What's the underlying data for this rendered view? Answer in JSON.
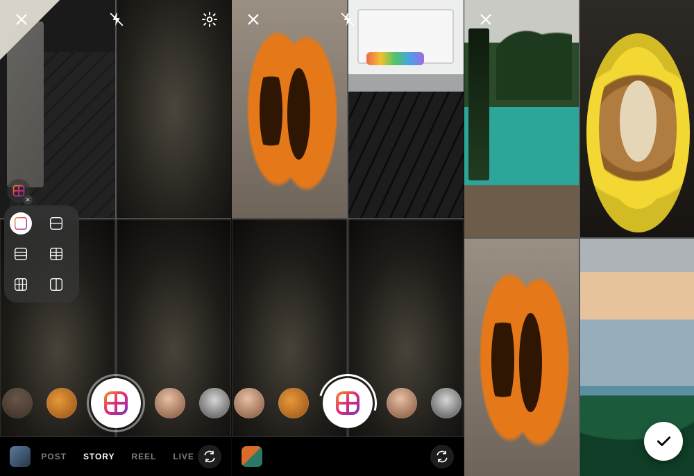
{
  "screens": {
    "left": {
      "topbar": {
        "close": "close-icon",
        "flash": "flash-off-icon",
        "settings": "settings-icon"
      },
      "layout_mini_icon": "layout-icon",
      "layout_options": [
        "grid-2x2",
        "rows-4",
        "rows-3",
        "grid-2x3",
        "grid-3x2",
        "cols-2"
      ],
      "layout_selected": "grid-2x2",
      "effects": [
        "face-dim",
        "food",
        "layout",
        "face",
        "alien"
      ],
      "modes": [
        "POST",
        "STORY",
        "REEL",
        "LIVE"
      ],
      "mode_active": "STORY",
      "gallery_thumb": "recent-photo",
      "switch_cam": "switch-camera-icon"
    },
    "middle": {
      "topbar": {
        "close": "close-icon",
        "flash": "flash-off-icon"
      },
      "filled": {
        "tl": "papaya",
        "tr": "laptop"
      },
      "effects": [
        "face",
        "food",
        "layout",
        "face",
        "alien"
      ],
      "shutter_progress": true,
      "gallery_thumb": "recent-photo",
      "switch_cam": "switch-camera-icon"
    },
    "right": {
      "topbar": {
        "close": "close-icon"
      },
      "tiles": {
        "tl": "pool",
        "tr": "coffee",
        "bl": "papaya",
        "br": "sea"
      },
      "confirm": "check-icon"
    }
  },
  "labels": {
    "mode_post": "POST",
    "mode_story": "STORY",
    "mode_reel": "REEL",
    "mode_live": "LIVE"
  },
  "colors": {
    "gradient_a": "#f58529",
    "gradient_b": "#dd2a7b",
    "gradient_c": "#8134af"
  }
}
